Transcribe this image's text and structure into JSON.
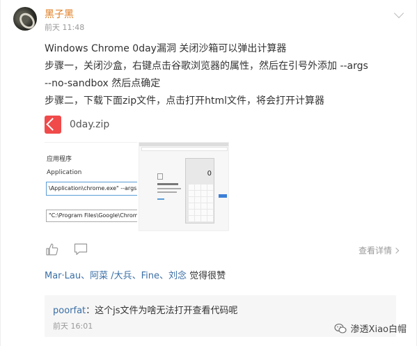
{
  "post": {
    "username": "黑子黑",
    "time": "前天 11:48",
    "lines": [
      "Windows Chrome 0day漏洞 关闭沙箱可以弹出计算器",
      "步骤一，关闭沙盒，右键点击谷歌浏览器的属性，然后在引号外添加   --args",
      "--no-sandbox     然后点确定",
      "步骤二，下载下面zip文件，点击打开html文件，将会打开计算器"
    ],
    "attachment": {
      "name": "0day.zip",
      "icon": "zip-file-icon"
    },
    "screenshot1": {
      "label1": "应用程序",
      "label2": "Application",
      "field1": "\\Application\\chrome.exe\" --args --",
      "field2": "\"C:\\Program Files\\Google\\Chrome\\"
    },
    "screenshot2": {
      "display": "0"
    },
    "actions": {
      "detail": "查看详情"
    },
    "likes": {
      "names": "Mar·Lau、阿菜 /大兵、Fine、刘念",
      "suffix": " 觉得很赞"
    },
    "comment": {
      "user": "poorfat",
      "text": "：这个js文件为啥无法打开查看代码呢",
      "time": "前天 16:01"
    }
  },
  "watermark": {
    "text": "渗透Xiao白帽"
  }
}
